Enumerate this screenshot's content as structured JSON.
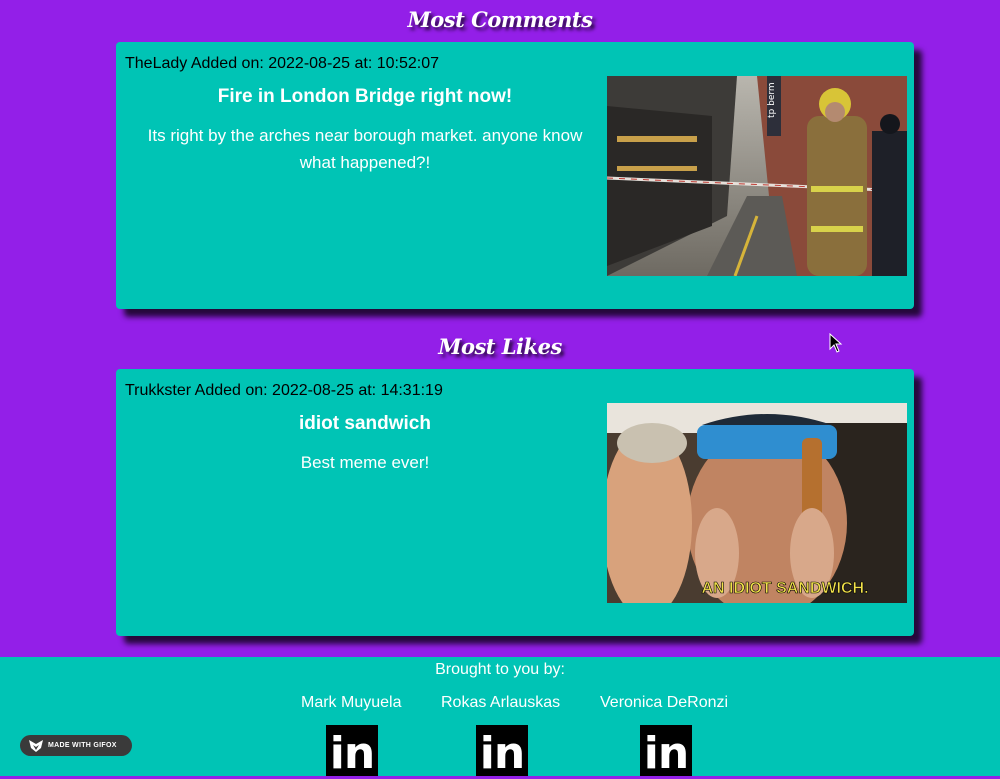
{
  "sections": {
    "most_comments": {
      "heading": "Most Comments",
      "post": {
        "meta": "TheLady Added on: 2022-08-25 at: 10:52:07",
        "title": "Fire in London Bridge right now!",
        "body": "Its right by the arches near borough market. anyone know what happened?!",
        "image_icon": "firefighter-photo",
        "image_text": "tp berm"
      }
    },
    "most_likes": {
      "heading": "Most Likes",
      "post": {
        "meta": "Trukkster Added on: 2022-08-25 at: 14:31:19",
        "title": "idiot sandwich",
        "body": "Best meme ever!",
        "image_icon": "idiot-sandwich-meme",
        "image_caption": "AN IDIOT SANDWICH."
      }
    }
  },
  "footer": {
    "brought_by": "Brought to you by:",
    "developers": [
      {
        "name": "Mark Muyuela",
        "icon": "linkedin-icon",
        "icon_text": "in"
      },
      {
        "name": "Rokas Arlauskas",
        "icon": "linkedin-icon",
        "icon_text": "in"
      },
      {
        "name": "Veronica DeRonzi",
        "icon": "linkedin-icon",
        "icon_text": "in"
      }
    ]
  },
  "badge": {
    "label": "MADE WITH GIFOX",
    "icon": "fox-icon"
  },
  "colors": {
    "background": "#931fe8",
    "card": "#00c4b5",
    "footer": "#00c4b5",
    "linkedin_tile": "#000000"
  }
}
